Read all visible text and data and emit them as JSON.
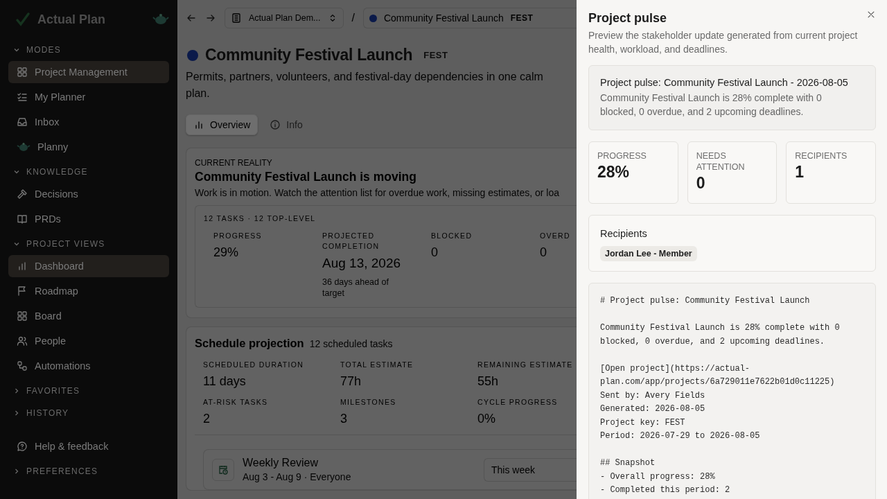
{
  "sidebar": {
    "brand": "Actual Plan",
    "entries": [
      {
        "kind": "section",
        "title": "MODES",
        "expanded": true,
        "items": [
          {
            "label": "Project Management",
            "selected": true
          },
          {
            "label": "My Planner",
            "selected": false
          },
          {
            "label": "Inbox",
            "selected": false
          },
          {
            "label": "Planny",
            "selected": false
          }
        ]
      },
      {
        "kind": "section",
        "title": "KNOWLEDGE",
        "expanded": true,
        "items": [
          {
            "label": "Decisions",
            "selected": false
          },
          {
            "label": "PRDs",
            "selected": false
          }
        ]
      },
      {
        "kind": "section",
        "title": "PROJECT VIEWS",
        "expanded": true,
        "items": [
          {
            "label": "Dashboard",
            "selected": true
          },
          {
            "label": "Roadmap",
            "selected": false
          },
          {
            "label": "Board",
            "selected": false
          },
          {
            "label": "People",
            "selected": false
          },
          {
            "label": "Automations",
            "selected": false
          }
        ]
      },
      {
        "kind": "section",
        "title": "FAVORITES",
        "expanded": false
      },
      {
        "kind": "section",
        "title": "HISTORY",
        "expanded": false
      },
      {
        "kind": "link",
        "label": "Help & feedback"
      },
      {
        "kind": "section",
        "title": "PREFERENCES",
        "expanded": false
      }
    ]
  },
  "topbar": {
    "workspace": "Actual Plan Dem...",
    "separator": "/",
    "project": "Community Festival Launch",
    "project_key": "FEST"
  },
  "header": {
    "title": "Community Festival Launch",
    "key": "FEST",
    "description": "Permits, partners, volunteers, and festival-day dependencies in one calm plan."
  },
  "tabs": [
    {
      "label": "Overview",
      "selected": true
    },
    {
      "label": "Info",
      "selected": false
    }
  ],
  "reality": {
    "eyebrow": "CURRENT REALITY",
    "title": "Community Festival Launch is moving",
    "text": "Work is in motion. Watch the attention list for overdue work, missing estimates, or loa",
    "summary": "12 TASKS · 12 TOP-LEVEL",
    "stats": [
      {
        "label": "PROGRESS",
        "value": "29%"
      },
      {
        "label": "PROJECTED COMPLETION",
        "value": "Aug 13, 2026",
        "note": "36 days ahead of target"
      },
      {
        "label": "BLOCKED",
        "value": "0"
      },
      {
        "label": "OVERD",
        "value": "0"
      }
    ]
  },
  "schedule": {
    "title": "Schedule projection",
    "count": "12 scheduled tasks",
    "stats": [
      {
        "label": "SCHEDULED DURATION",
        "value": "11 days"
      },
      {
        "label": "TOTAL ESTIMATE",
        "value": "77h"
      },
      {
        "label": "REMAINING ESTIMATE",
        "value": "55h"
      },
      {
        "label": "AT-RISK TASKS",
        "value": "2"
      },
      {
        "label": "MILESTONES",
        "value": "3"
      },
      {
        "label": "CYCLE PROGRESS",
        "value": "0%"
      }
    ]
  },
  "review": {
    "title": "Weekly Review",
    "subtitle": "Aug 3 - Aug 9 · Everyone",
    "range": "This week"
  },
  "drawer": {
    "title": "Project pulse",
    "description": "Preview the stakeholder update generated from current project health, workload, and deadlines.",
    "summary": {
      "title": "Project pulse: Community Festival Launch - 2026-08-05",
      "text": "Community Festival Launch is 28% complete with 0 blocked, 0 overdue, and 2 upcoming deadlines."
    },
    "stats": [
      {
        "label": "PROGRESS",
        "value": "28%"
      },
      {
        "label": "NEEDS ATTENTION",
        "value": "0"
      },
      {
        "label": "RECIPIENTS",
        "value": "1"
      }
    ],
    "recipients": {
      "title": "Recipients",
      "chips": [
        "Jordan Lee - Member"
      ]
    },
    "markdown": [
      [
        "# Project pulse: Community Festival Launch"
      ],
      [
        "Community Festival Launch is 28% complete with 0 blocked, 0 overdue, and 2 upcoming deadlines."
      ],
      [
        "[Open project](https://actual-plan.com/app/projects/6a729011e7622b01d0c11225)",
        "Sent by: Avery Fields",
        "Generated: 2026-08-05",
        "Project key: FEST",
        "Period: 2026-07-29 to 2026-08-05"
      ],
      [
        "## Snapshot",
        "- Overall progress: 28%",
        "- Completed this period: 2"
      ]
    ]
  }
}
